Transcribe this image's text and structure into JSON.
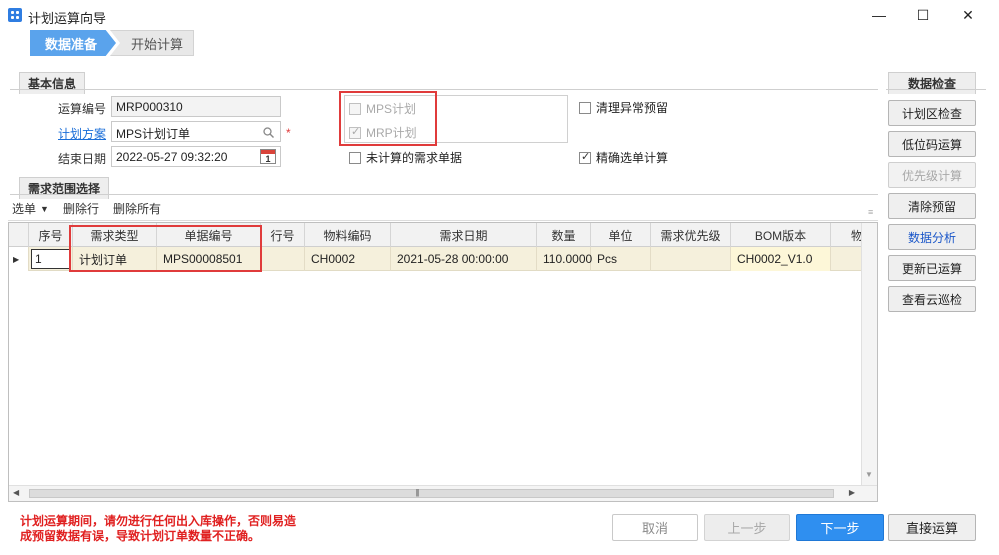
{
  "window": {
    "title": "计划运算向导",
    "min": "—",
    "max": "☐",
    "close": "✕"
  },
  "steps": [
    {
      "label": "数据准备",
      "active": true
    },
    {
      "label": "开始计算",
      "active": false
    }
  ],
  "basic_info": {
    "section_title": "基本信息",
    "run_number_label": "运算编号",
    "run_number_value": "MRP000310",
    "plan_scheme_label": "计划方案",
    "plan_scheme_value": "MPS计划订单",
    "end_date_label": "结束日期",
    "end_date_value": "2022-05-27 09:32:20",
    "calendar_day": "1",
    "required_mark": "*",
    "mps_plan_label": "MPS计划",
    "mrp_plan_label": "MRP计划",
    "clear_reserve_label": "清理异常预留",
    "uncalc_demand_label": "未计算的需求单据",
    "precise_calc_label": "精确选单计算"
  },
  "demand_range": {
    "section_title": "需求范围选择",
    "toolbar": {
      "select": "选单",
      "delete_row": "删除行",
      "delete_all": "删除所有"
    },
    "columns": [
      "序号",
      "需求类型",
      "单据编号",
      "行号",
      "物料编码",
      "需求日期",
      "数量",
      "单位",
      "需求优先级",
      "BOM版本",
      "物"
    ],
    "rows": [
      [
        "1",
        "计划订单",
        "MPS00008501",
        "",
        "CH0002",
        "2021-05-28 00:00:00",
        "110.0000",
        "Pcs",
        "",
        "CH0002_V1.0",
        ""
      ]
    ]
  },
  "data_check": {
    "title": "数据检查",
    "buttons": [
      {
        "label": "计划区检查",
        "state": "normal"
      },
      {
        "label": "低位码运算",
        "state": "normal"
      },
      {
        "label": "优先级计算",
        "state": "disabled"
      },
      {
        "label": "清除预留",
        "state": "normal"
      },
      {
        "label": "数据分析",
        "state": "blue"
      },
      {
        "label": "更新已运算",
        "state": "normal"
      },
      {
        "label": "查看云巡检",
        "state": "normal"
      }
    ]
  },
  "warning": {
    "line1": "计划运算期间，请勿进行任何出入库操作，否则易造",
    "line2": "成预留数据有误，导致计划订单数量不正确。"
  },
  "footer": {
    "cancel": "取消",
    "prev": "上一步",
    "next": "下一步",
    "direct": "直接运算"
  },
  "colors": {
    "accent": "#5aa3ec",
    "primary_button": "#2f8ff0",
    "warning": "#e02020",
    "highlight_box": "#e03b3b"
  }
}
